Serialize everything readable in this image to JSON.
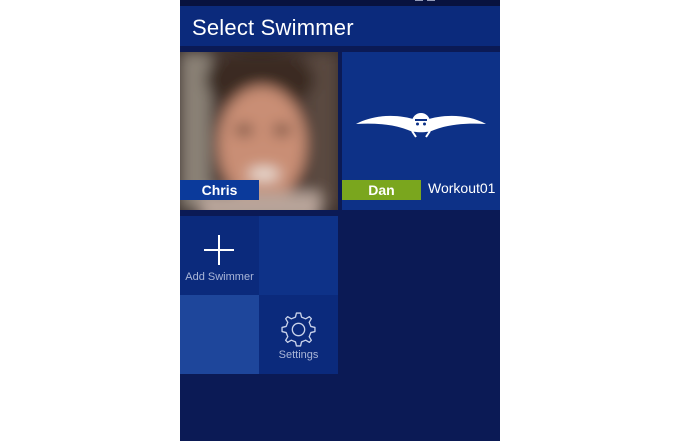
{
  "header": {
    "title": "Select Swimmer"
  },
  "swimmers": [
    {
      "name": "Chris",
      "badge_color": "#0b3a9b"
    },
    {
      "name": "Dan",
      "badge_color": "#7aa61e",
      "workout": "Workout01"
    }
  ],
  "tiles": {
    "add_swimmer_label": "Add Swimmer",
    "settings_label": "Settings"
  },
  "icons": [
    "plus-icon",
    "gear-icon",
    "swimmer-silhouette-icon"
  ],
  "colors": {
    "background": "#0b1a55",
    "header": "#0b2a7c",
    "tile_dark": "#0b2a7c",
    "tile_mid": "#0e3288",
    "tile_light": "#1e469b",
    "accent_green": "#7aa61e"
  }
}
